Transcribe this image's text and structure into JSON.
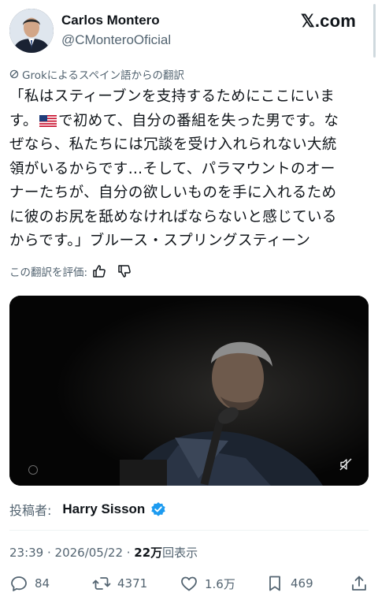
{
  "author": {
    "name": "Carlos Montero",
    "handle": "@CMonteroOficial"
  },
  "site_logo": "𝕏.com",
  "translation_note": "Grokによるスペイン語からの翻訳",
  "tweet": {
    "lines": [
      "「私はスティーブンを支持するためにここにいま",
      "で初めて、自分の番組を失った男です。な",
      "ぜなら、私たちには冗談を受け入れられない大統",
      "領がいるからです…そして、パラマウントのオー",
      "ナーたちが、自分の欲しいものを手に入れるため",
      "に彼のお尻を舐めなければならないと感じている",
      "からです。」ブルース・スプリングスティーン"
    ],
    "line2_prefix": "す。"
  },
  "rate": {
    "label": "この翻訳を評価:"
  },
  "poster": {
    "label": "投稿者:",
    "name": "Harry Sisson"
  },
  "meta": {
    "datetime": "23:39 · 2026/05/22 · ",
    "views_count": "22万",
    "views_label": "回表示"
  },
  "actions": {
    "replies": "84",
    "reposts": "4371",
    "likes": "1.6万",
    "bookmarks": "469"
  },
  "colors": {
    "verified": "#1d9bf0",
    "text": "#0f1419",
    "muted": "#536471"
  },
  "icons": {
    "avatar": "avatar-photo",
    "logo": "x-logo",
    "flag": "us-flag-icon",
    "verified": "verified-badge-icon",
    "mute": "muted-speaker-icon"
  }
}
